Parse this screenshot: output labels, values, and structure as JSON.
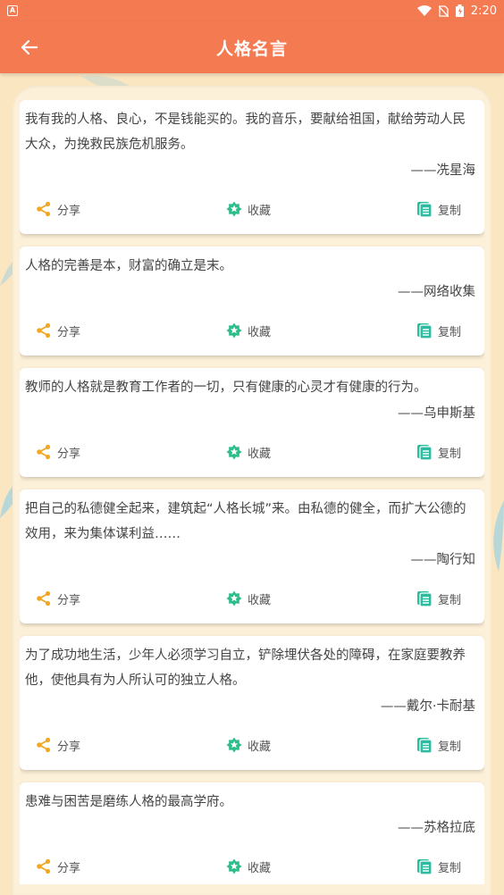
{
  "status_bar": {
    "app_badge": "A",
    "time": "2:20"
  },
  "header": {
    "title": "人格名言"
  },
  "actions": {
    "share": "分享",
    "collect": "收藏",
    "copy": "复制"
  },
  "colors": {
    "primary": "#f47a52",
    "share": "#f5a623",
    "collect": "#2bbd8a",
    "copy": "#2bbda0"
  },
  "quotes": [
    {
      "text": "我有我的人格、良心，不是钱能买的。我的音乐，要献给祖国，献给劳动人民大众，为挽救民族危机服务。",
      "author": "——冼星海"
    },
    {
      "text": "人格的完善是本，财富的确立是末。",
      "author": "——网络收集"
    },
    {
      "text": "教师的人格就是教育工作者的一切，只有健康的心灵才有健康的行为。",
      "author": "——乌申斯基"
    },
    {
      "text": "把自己的私德健全起来，建筑起“人格长城”来。由私德的健全，而扩大公德的效用，来为集体谋利益……",
      "author": "——陶行知"
    },
    {
      "text": "为了成功地生活，少年人必须学习自立，铲除埋伏各处的障碍，在家庭要教养他，使他具有为人所认可的独立人格。",
      "author": "——戴尔·卡耐基"
    },
    {
      "text": "患难与困苦是磨练人格的最高学府。",
      "author": "——苏格拉底"
    }
  ]
}
